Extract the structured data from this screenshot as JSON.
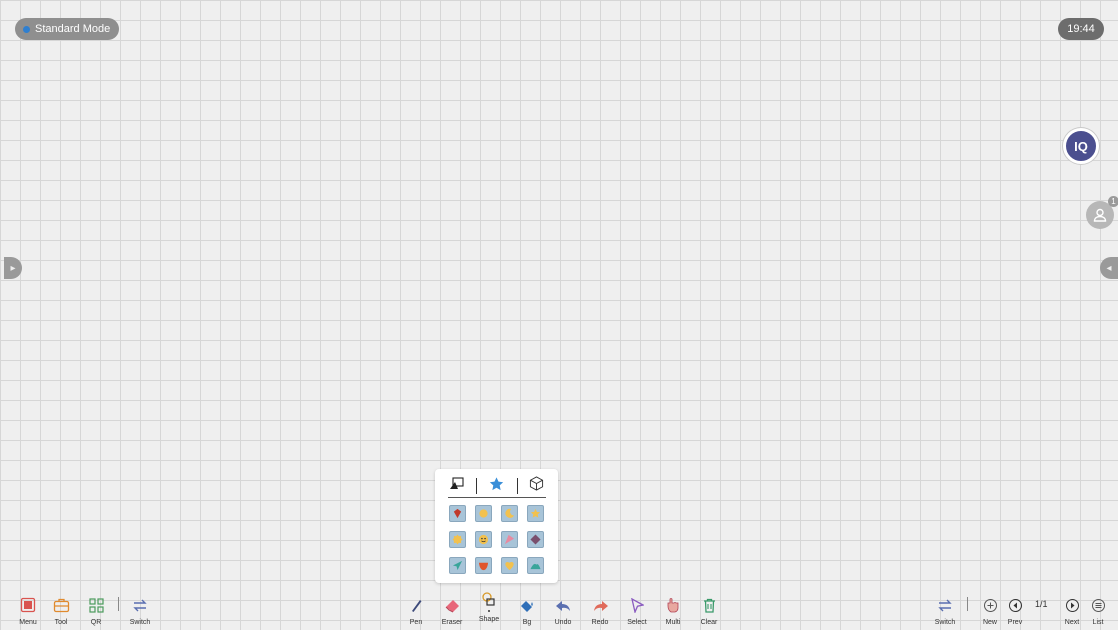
{
  "header": {
    "mode_label": "Standard Mode",
    "time": "19:44"
  },
  "side": {
    "user_count": "1",
    "iq_label": "IQ"
  },
  "shape_panel": {
    "tabs": [
      "shape-tool-icon",
      "star-icon",
      "cube-icon"
    ],
    "cells": [
      {
        "icon": "ruby-icon",
        "color": "#c0392b"
      },
      {
        "icon": "sun-icon",
        "color": "#f2c14e"
      },
      {
        "icon": "moon-icon",
        "color": "#f2c14e"
      },
      {
        "icon": "star-icon",
        "color": "#f2c14e"
      },
      {
        "icon": "badge-icon",
        "color": "#f2c14e"
      },
      {
        "icon": "smiley-icon",
        "color": "#f2c14e"
      },
      {
        "icon": "flag-icon",
        "color": "#e88aa0"
      },
      {
        "icon": "diamond-icon",
        "color": "#7a4f6d"
      },
      {
        "icon": "plane-icon",
        "color": "#3aa59a"
      },
      {
        "icon": "bowl-icon",
        "color": "#e0552d"
      },
      {
        "icon": "heart-icon",
        "color": "#f2c14e"
      },
      {
        "icon": "hill-icon",
        "color": "#3aa59a"
      }
    ]
  },
  "toolbar": {
    "left": [
      {
        "label": "Menu",
        "icon": "menu-icon"
      },
      {
        "label": "Tool",
        "icon": "toolbox-icon"
      },
      {
        "label": "QR",
        "icon": "qr-icon"
      },
      {
        "label": "Switch",
        "icon": "switch-icon"
      }
    ],
    "center": [
      {
        "label": "Pen",
        "icon": "pen-icon"
      },
      {
        "label": "Eraser",
        "icon": "eraser-icon"
      },
      {
        "label": "Shape",
        "icon": "shape-icon"
      },
      {
        "label": "Bg",
        "icon": "bg-icon"
      },
      {
        "label": "Undo",
        "icon": "undo-icon"
      },
      {
        "label": "Redo",
        "icon": "redo-icon"
      },
      {
        "label": "Select",
        "icon": "select-icon"
      },
      {
        "label": "Multi",
        "icon": "multi-touch-icon"
      },
      {
        "label": "Clear",
        "icon": "trash-icon"
      }
    ],
    "right": [
      {
        "label": "Switch",
        "icon": "switch-icon"
      },
      {
        "label": "New",
        "icon": "plus-icon"
      },
      {
        "label": "Prev",
        "icon": "prev-icon"
      },
      {
        "label": "Next",
        "icon": "next-icon"
      },
      {
        "label": "List",
        "icon": "list-icon"
      }
    ],
    "page_count": "1/1"
  }
}
